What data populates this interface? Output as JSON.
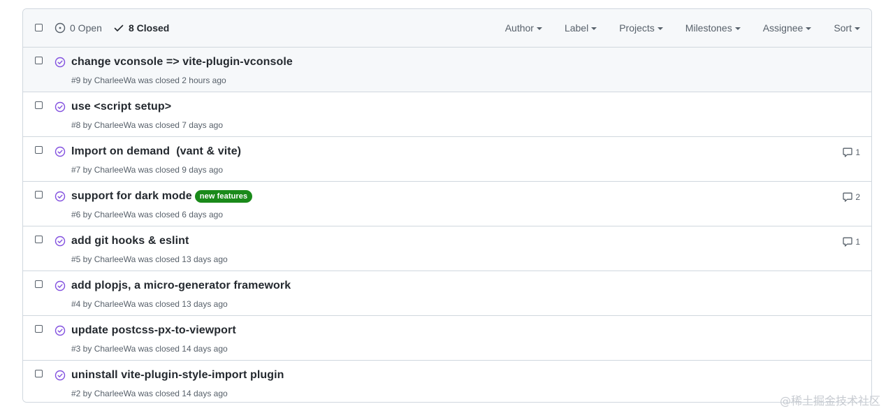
{
  "header": {
    "open_label": "0 Open",
    "closed_label": "8 Closed",
    "filters": [
      "Author",
      "Label",
      "Projects",
      "Milestones",
      "Assignee",
      "Sort"
    ]
  },
  "colors": {
    "closed_icon": "#8250df",
    "label_green": "#1a8a1a"
  },
  "issues": [
    {
      "title": "change vconsole => vite-plugin-vconsole",
      "meta": "#9 by CharleeWa was closed 2 hours ago",
      "comments": "",
      "label": ""
    },
    {
      "title": "use <script setup>",
      "meta": "#8 by CharleeWa was closed 7 days ago",
      "comments": "",
      "label": ""
    },
    {
      "title": "Import on demand  (vant & vite)",
      "meta": "#7 by CharleeWa was closed 9 days ago",
      "comments": "1",
      "label": ""
    },
    {
      "title": "support for dark mode",
      "meta": "#6 by CharleeWa was closed 6 days ago",
      "comments": "2",
      "label": "new features"
    },
    {
      "title": "add git hooks & eslint",
      "meta": "#5 by CharleeWa was closed 13 days ago",
      "comments": "1",
      "label": ""
    },
    {
      "title": "add plopjs, a micro-generator framework",
      "meta": "#4 by CharleeWa was closed 13 days ago",
      "comments": "",
      "label": ""
    },
    {
      "title": "update postcss-px-to-viewport",
      "meta": "#3 by CharleeWa was closed 14 days ago",
      "comments": "",
      "label": ""
    },
    {
      "title": "uninstall vite-plugin-style-import plugin",
      "meta": "#2 by CharleeWa was closed 14 days ago",
      "comments": "",
      "label": ""
    }
  ],
  "watermark": "@稀土掘金技术社区"
}
